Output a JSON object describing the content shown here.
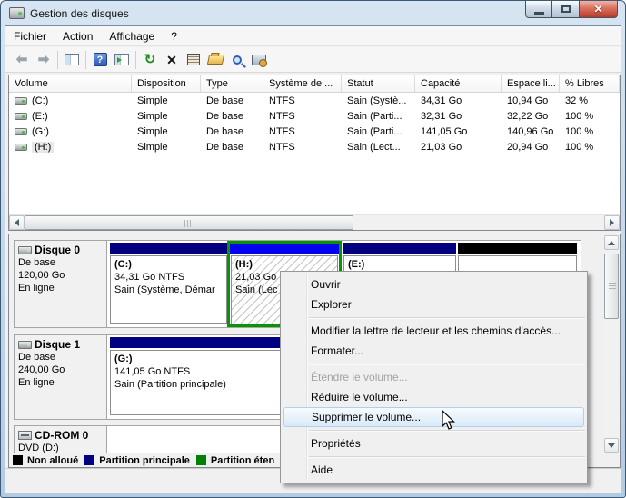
{
  "window": {
    "title": "Gestion des disques"
  },
  "titlebar_icons": [
    "computer-drive-icon",
    "minimize-icon",
    "maximize-icon",
    "close-icon"
  ],
  "menubar": {
    "items": [
      "Fichier",
      "Action",
      "Affichage",
      "?"
    ]
  },
  "toolbar": {
    "icons": [
      "back-icon",
      "forward-icon",
      "console-tree-icon",
      "help-icon",
      "action-pane-icon",
      "refresh-icon",
      "delete-icon",
      "properties-icon",
      "open-folder-icon",
      "search-icon",
      "computer-manage-icon"
    ]
  },
  "colors": {
    "unallocated": "#000000",
    "primary_partition": "#000080",
    "extended_partition": "#008000",
    "selected_strip": "#0202f0"
  },
  "volume_table": {
    "columns": [
      "Volume",
      "Disposition",
      "Type",
      "Système de ...",
      "Statut",
      "Capacité",
      "Espace li...",
      "% Libres"
    ],
    "rows": [
      [
        "(C:)",
        "Simple",
        "De base",
        "NTFS",
        "Sain (Systè...",
        "34,31 Go",
        "10,94 Go",
        "32 %"
      ],
      [
        "(E:)",
        "Simple",
        "De base",
        "NTFS",
        "Sain (Parti...",
        "32,31 Go",
        "32,22 Go",
        "100 %"
      ],
      [
        "(G:)",
        "Simple",
        "De base",
        "NTFS",
        "Sain (Parti...",
        "141,05 Go",
        "140,96 Go",
        "100 %"
      ],
      [
        "(H:)",
        "Simple",
        "De base",
        "NTFS",
        "Sain (Lect...",
        "21,03 Go",
        "20,94 Go",
        "100 %"
      ]
    ]
  },
  "disks": [
    {
      "label": "Disque 0",
      "kind": "De base",
      "size": "120,00 Go",
      "status": "En ligne",
      "partitions": [
        {
          "name": "(C:)",
          "size_line": "34,31 Go NTFS",
          "status_line": "Sain (Système, Démar"
        },
        {
          "name": "(H:)",
          "size_line": "21,03 Go",
          "status_line": "Sain (Lec"
        },
        {
          "name": "(E:)",
          "size_line": "",
          "status_line": ""
        },
        {
          "name": "",
          "size_line": "",
          "status_line": ""
        }
      ]
    },
    {
      "label": "Disque 1",
      "kind": "De base",
      "size": "240,00 Go",
      "status": "En ligne",
      "partitions": [
        {
          "name": "(G:)",
          "size_line": "141,05 Go NTFS",
          "status_line": "Sain (Partition principale)"
        }
      ]
    },
    {
      "label": "CD-ROM 0",
      "kind": "DVD (D:)",
      "size": "",
      "status": ""
    }
  ],
  "legend": [
    {
      "label": "Non alloué",
      "color": "#000000"
    },
    {
      "label": "Partition principale",
      "color": "#000080"
    },
    {
      "label": "Partition éten",
      "color": "#008000"
    }
  ],
  "context_menu": {
    "items": [
      "Ouvrir",
      "Explorer",
      "Modifier la lettre de lecteur et les chemins d'accès...",
      "Formater...",
      "Étendre le volume...",
      "Réduire le volume...",
      "Supprimer le volume...",
      "Propriétés",
      "Aide"
    ]
  }
}
